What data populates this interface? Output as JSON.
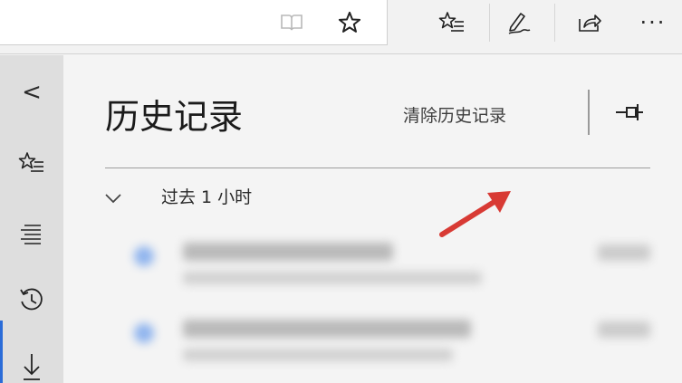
{
  "toolbar": {
    "items": [
      "reading-view",
      "favorite-star",
      "favorites-hub",
      "notes",
      "share",
      "more"
    ],
    "more_label": "···"
  },
  "rail": {
    "items": [
      "collapse",
      "favorites",
      "reading-list",
      "history",
      "downloads"
    ],
    "collapse_label": "<",
    "active": "history"
  },
  "panel": {
    "title": "历史记录",
    "clear_history": "清除历史记录",
    "group_label": "过去 1 小时"
  },
  "colors": {
    "accent": "#2b6cd8",
    "annotation_arrow": "#d83a34",
    "favicon": "#8fb4ee"
  }
}
